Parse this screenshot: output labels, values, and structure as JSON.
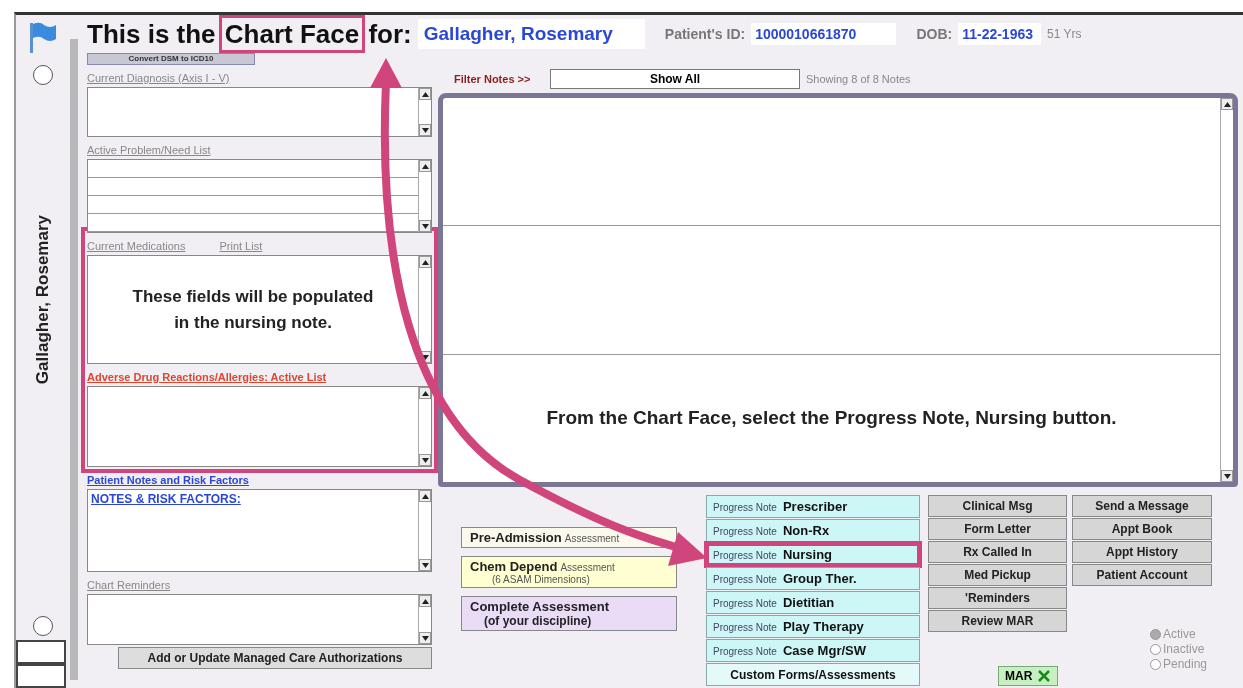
{
  "header": {
    "title": {
      "before": "This is the",
      "highlighted": "Chart Face",
      "after": "for:"
    },
    "patient_name": "Gallagher, Rosemary",
    "id_label": "Patient's ID:",
    "patient_id": "1000010661870",
    "dob_label": "DOB:",
    "dob": "11-22-1963",
    "age": "51 Yrs"
  },
  "side_rail": {
    "patient_name": "Gallagher, Rosemary"
  },
  "convert_button": "Convert DSM to ICD10",
  "sections": [
    {
      "kind": "diagnosis",
      "label": "Current Diagnosis (Axis I - V)",
      "highlighted": false
    },
    {
      "kind": "problems",
      "label": "Active Problem/Need List",
      "highlighted": false
    },
    {
      "kind": "medications",
      "label": "Current Medications",
      "link": "Print List",
      "note": "These fields will be populated in the nursing note.",
      "highlighted": true
    },
    {
      "kind": "allergies",
      "label": "Adverse Drug Reactions/Allergies:  Active List",
      "highlighted": true
    },
    {
      "kind": "notes",
      "label": "Patient Notes and Risk Factors",
      "value": "NOTES & RISK FACTORS:",
      "highlighted": false
    },
    {
      "kind": "reminders",
      "label": "Chart Reminders",
      "highlighted": false
    }
  ],
  "auth_button": "Add or Update Managed Care Authorizations",
  "filter": {
    "label": "Filter Notes >>",
    "button": "Show All",
    "status": "Showing 8 of 8 Notes"
  },
  "notes_panel": {
    "callout": "From the Chart Face, select the Progress Note, Nursing button."
  },
  "assessments": [
    {
      "title": "Pre-Admission",
      "suffix": "Assessment",
      "color": "#fbf9ec"
    },
    {
      "title": "Chem Depend",
      "suffix": "Assessment",
      "sub": "(6 ASAM Dimensions)",
      "color": "#ffffd2"
    },
    {
      "title": "Complete Assessment",
      "sub": "(of your discipline)",
      "color": "#eadcf6"
    }
  ],
  "progress_notes": [
    {
      "kind": "progress",
      "prefix": "Progress Note",
      "label": "Prescriber",
      "highlighted": false
    },
    {
      "kind": "progress",
      "prefix": "Progress Note",
      "label": "Non-Rx",
      "highlighted": false
    },
    {
      "kind": "progress",
      "prefix": "Progress Note",
      "label": "Nursing",
      "highlighted": true
    },
    {
      "kind": "progress",
      "prefix": "Progress Note",
      "label": "Group Ther.",
      "highlighted": false
    },
    {
      "kind": "progress",
      "prefix": "Progress Note",
      "label": "Dietitian",
      "highlighted": false
    },
    {
      "kind": "progress",
      "prefix": "Progress Note",
      "label": "Play Therapy",
      "highlighted": false
    },
    {
      "kind": "progress",
      "prefix": "Progress Note",
      "label": "Case Mgr/SW",
      "highlighted": false
    },
    {
      "kind": "custom",
      "label": "Custom Forms/Assessments",
      "highlighted": false
    }
  ],
  "tools": [
    "Clinical Msg",
    "Form Letter",
    "Rx Called In",
    "Med Pickup",
    "'Reminders",
    "Review MAR"
  ],
  "account": [
    "Send a Message",
    "Appt Book",
    "Appt History",
    "Patient Account"
  ],
  "mar_button": "MAR",
  "status_options": [
    {
      "label": "Active",
      "selected": true
    },
    {
      "label": "Inactive",
      "selected": false
    },
    {
      "label": "Pending",
      "selected": false
    }
  ]
}
